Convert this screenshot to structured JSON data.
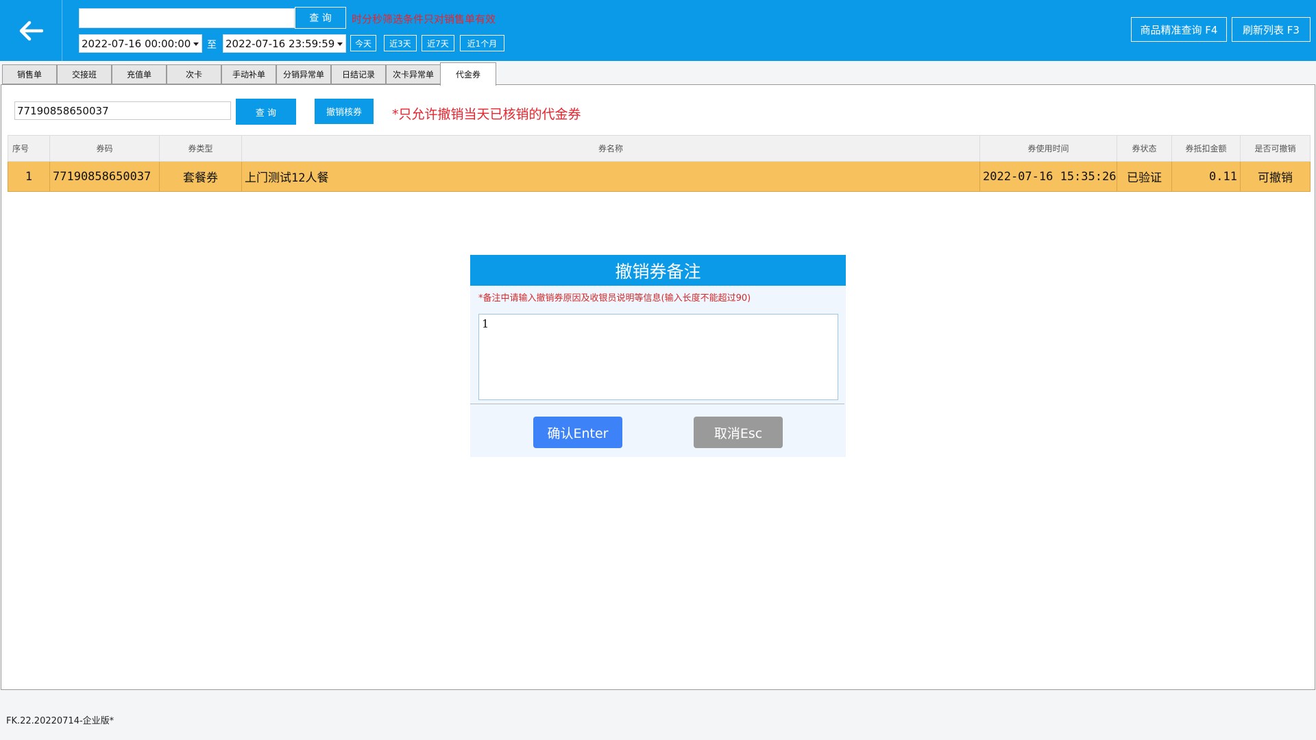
{
  "header": {
    "keyword_value": "",
    "query_label": "查 询",
    "hint": "时分秒筛选条件只对销售单有效",
    "date_from": "2022-07-16 00:00:00",
    "date_sep": "至",
    "date_to": "2022-07-16 23:59:59",
    "quick": [
      "今天",
      "近3天",
      "近7天",
      "近1个月"
    ],
    "exact_query_label": "商品精准查询 F4",
    "refresh_label": "刷新列表 F3"
  },
  "tabs": [
    "销售单",
    "交接班",
    "充值单",
    "次卡",
    "手动补单",
    "分销异常单",
    "日结记录",
    "次卡异常单",
    "代金券"
  ],
  "active_tab": "代金券",
  "voucher_panel": {
    "code_value": "77190858650037",
    "query_label": "查 询",
    "revoke_label": "撤销核券",
    "hint": "*只允许撤销当天已核销的代金券"
  },
  "table": {
    "columns": [
      "序号",
      "券码",
      "券类型",
      "券名称",
      "券使用时间",
      "券状态",
      "券抵扣金额",
      "是否可撤销"
    ],
    "rows": [
      [
        "1",
        "77190858650037",
        "套餐券",
        "上门测试12人餐",
        "2022-07-16 15:35:26",
        "已验证",
        "0.11",
        "可撤销"
      ]
    ]
  },
  "modal": {
    "title": "撤销券备注",
    "note": "*备注中请输入撤销券原因及收银员说明等信息(输入长度不能超过90)",
    "value": "1",
    "confirm_label": "确认Enter",
    "cancel_label": "取消Esc"
  },
  "footer": {
    "version": "FK.22.20220714-企业版*"
  },
  "colors": {
    "header_bg": "#0b9ae8",
    "row_highlight": "#f7c25e",
    "warning_red": "#e8232d",
    "confirm_blue": "#3e82f7",
    "cancel_gray": "#9a9a9a"
  },
  "icons": {
    "back": "arrow-left-icon",
    "dropdown": "caret-down-icon"
  }
}
